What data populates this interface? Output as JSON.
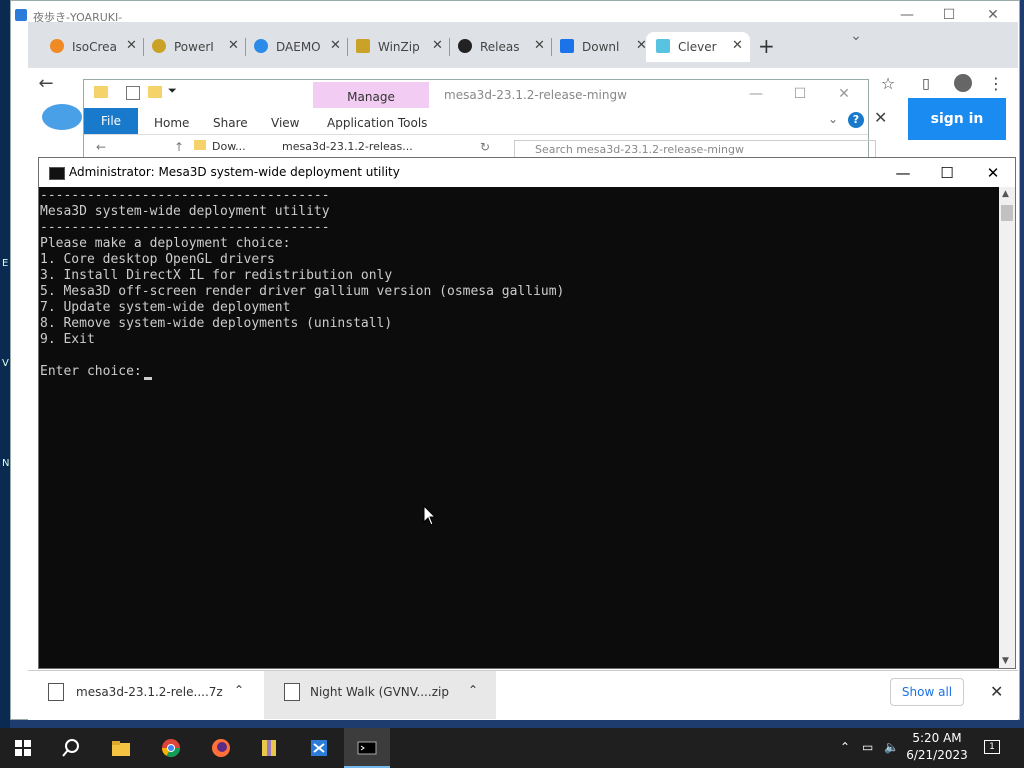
{
  "background_window": {
    "title": "夜歩き-YOARUKI-"
  },
  "browser": {
    "tabs": [
      {
        "label": "IsoCrea",
        "icon": "isocreator-icon",
        "color": "#f08a24"
      },
      {
        "label": "PowerI",
        "icon": "poweriso-icon",
        "color": "#c9a227"
      },
      {
        "label": "DAEMO",
        "icon": "daemon-tools-icon",
        "color": "#2b8be6"
      },
      {
        "label": "WinZip",
        "icon": "winzip-icon",
        "color": "#c9a227"
      },
      {
        "label": "Releas",
        "icon": "github-icon",
        "color": "#222222"
      },
      {
        "label": "Downl",
        "icon": "download-icon",
        "color": "#1a73e8"
      },
      {
        "label": "Clever",
        "icon": "cleverbot-icon",
        "color": "#58c3e0"
      }
    ],
    "new_tab_label": "+",
    "signin_label": "sign in",
    "close_label": "✕"
  },
  "downloads": {
    "items": [
      {
        "label": "mesa3d-23.1.2-rele....7z"
      },
      {
        "label": "Night Walk (GVNV....zip"
      }
    ],
    "show_all_label": "Show all",
    "close_label": "✕"
  },
  "explorer": {
    "context_tab": "Manage",
    "path_title": "mesa3d-23.1.2-release-mingw",
    "ribbon_tabs": [
      "File",
      "Home",
      "Share",
      "View",
      "Application Tools"
    ],
    "address_prefix": "Dow...",
    "address_folder": "mesa3d-23.1.2-releas...",
    "search_placeholder": "Search mesa3d-23.1.2-release-mingw",
    "help_label": "?"
  },
  "console": {
    "title": "Administrator:  Mesa3D system-wide deployment utility",
    "lines": [
      "-------------------------------------",
      "Mesa3D system-wide deployment utility",
      "-------------------------------------",
      "Please make a deployment choice:",
      "1. Core desktop OpenGL drivers",
      "3. Install DirectX IL for redistribution only",
      "5. Mesa3D off-screen render driver gallium version (osmesa gallium)",
      "7. Update system-wide deployment",
      "8. Remove system-wide deployments (uninstall)",
      "9. Exit",
      "",
      "Enter choice:"
    ]
  },
  "taskbar": {
    "apps": [
      {
        "name": "start",
        "icon": "windows-start-icon"
      },
      {
        "name": "search",
        "icon": "search-icon"
      },
      {
        "name": "file-explorer",
        "icon": "folder-icon"
      },
      {
        "name": "chrome",
        "icon": "chrome-icon"
      },
      {
        "name": "firefox",
        "icon": "firefox-icon"
      },
      {
        "name": "winrar",
        "icon": "archive-icon"
      },
      {
        "name": "app",
        "icon": "app-icon"
      },
      {
        "name": "console",
        "icon": "console-icon"
      }
    ],
    "time": "5:20 AM",
    "date": "6/21/2023",
    "notification_count": "1"
  }
}
